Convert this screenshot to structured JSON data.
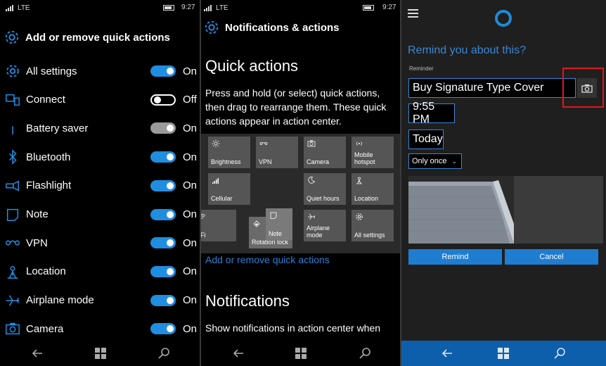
{
  "status_bar": {
    "network": "LTE",
    "time": "9:27"
  },
  "panel1": {
    "title": "Add or remove quick actions",
    "title_icon": "gear-icon",
    "rows": [
      {
        "label": "All settings",
        "icon": "gear-icon",
        "state": "On",
        "on": true
      },
      {
        "label": "Connect",
        "icon": "connect-icon",
        "state": "Off",
        "on": false
      },
      {
        "label": "Battery saver",
        "icon": "battery-saver-icon",
        "state": "On",
        "on": true,
        "disabled": true
      },
      {
        "label": "Bluetooth",
        "icon": "bluetooth-icon",
        "state": "On",
        "on": true
      },
      {
        "label": "Flashlight",
        "icon": "flashlight-icon",
        "state": "On",
        "on": true
      },
      {
        "label": "Note",
        "icon": "note-icon",
        "state": "On",
        "on": true
      },
      {
        "label": "VPN",
        "icon": "vpn-icon",
        "state": "On",
        "on": true
      },
      {
        "label": "Location",
        "icon": "location-icon",
        "state": "On",
        "on": true
      },
      {
        "label": "Airplane mode",
        "icon": "airplane-icon",
        "state": "On",
        "on": true
      },
      {
        "label": "Camera",
        "icon": "camera-icon",
        "state": "On",
        "on": true
      }
    ]
  },
  "panel2": {
    "title": "Notifications & actions",
    "quick_actions_heading": "Quick actions",
    "quick_actions_desc": "Press and hold (or select) quick actions, then drag to rearrange them. These quick actions appear in action center.",
    "tiles": [
      {
        "label": "Brightness",
        "icon": "brightness-icon"
      },
      {
        "label": "VPN",
        "icon": "vpn-icon"
      },
      {
        "label": "Camera",
        "icon": "camera-icon"
      },
      {
        "label": "Mobile hotspot",
        "icon": "hotspot-icon"
      },
      {
        "label": "Cellular",
        "icon": "cellular-icon"
      },
      {
        "label": "Quiet hours",
        "icon": "moon-icon"
      },
      {
        "label": "Location",
        "icon": "location-icon"
      },
      {
        "label": "i-Fi",
        "icon": "wifi-icon"
      },
      {
        "label": "Rotation lock",
        "icon": "rotation-lock-icon"
      },
      {
        "label": "Note",
        "icon": "note-icon"
      },
      {
        "label": "Airplane mode",
        "icon": "airplane-icon"
      },
      {
        "label": "All settings",
        "icon": "gear-icon"
      }
    ],
    "link": "Add or remove quick actions",
    "notifications_heading": "Notifications",
    "notifications_desc": "Show notifications in action center when"
  },
  "panel3": {
    "question": "Remind you about this?",
    "reminder_label": "Reminder",
    "reminder_value": "Buy Signature Type Cover",
    "time_value": "9:55 PM",
    "day_value": "Today",
    "repeat_value": "Only once",
    "remind_button": "Remind",
    "cancel_button": "Cancel"
  },
  "colors": {
    "accent": "#1f8ee0",
    "cortana_blue": "#3a86d6",
    "highlight_red": "#e3181a"
  }
}
